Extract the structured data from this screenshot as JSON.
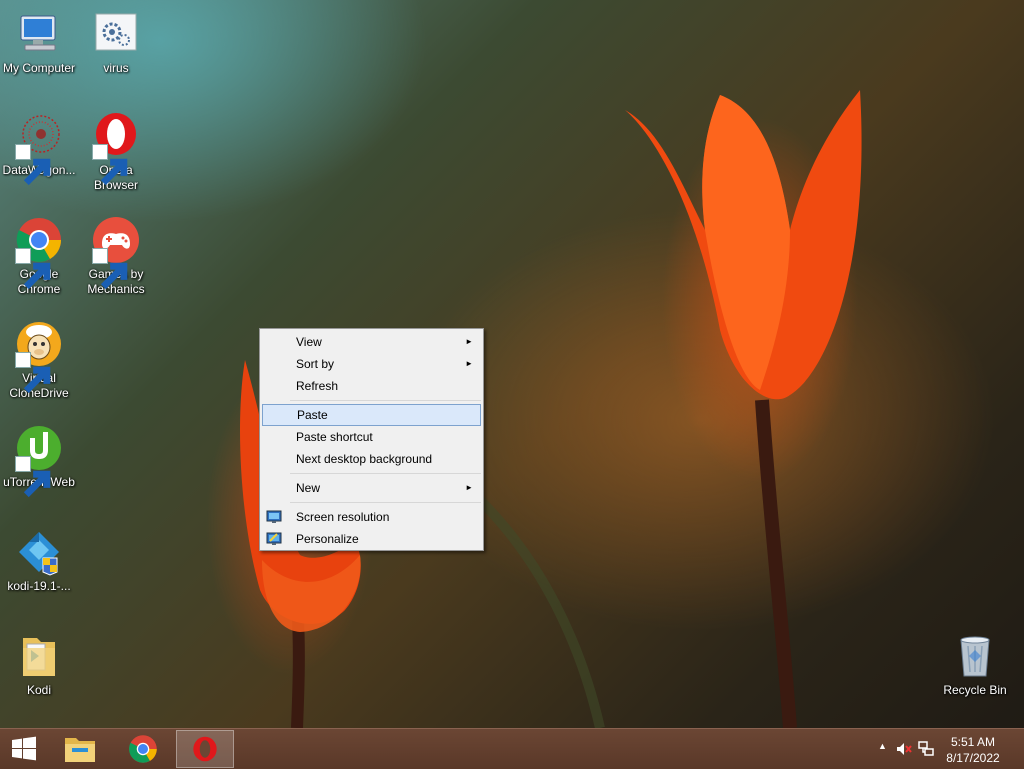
{
  "desktop": {
    "icons": [
      {
        "label": "My Computer",
        "icon": "computer-icon"
      },
      {
        "label": "virus",
        "icon": "settings-file-icon"
      },
      {
        "label": "DataWagon...",
        "icon": "datawagon-icon",
        "shortcut": true
      },
      {
        "label": "Opera Browser",
        "icon": "opera-icon",
        "shortcut": true
      },
      {
        "label": "Google Chrome",
        "icon": "chrome-icon",
        "shortcut": true
      },
      {
        "label": "Games by Mechanics",
        "icon": "gamepad-icon",
        "shortcut": true
      },
      {
        "label": "Virtual CloneDrive",
        "icon": "sheep-icon",
        "shortcut": true
      },
      {
        "label": "uTorrent Web",
        "icon": "utorrent-icon",
        "shortcut": true
      },
      {
        "label": "kodi-19.1-...",
        "icon": "kodi-installer-icon"
      },
      {
        "label": "Kodi",
        "icon": "folder-icon"
      },
      {
        "label": "Recycle Bin",
        "icon": "recycle-bin-icon"
      }
    ]
  },
  "context_menu": {
    "items": [
      {
        "label": "View",
        "submenu": true
      },
      {
        "label": "Sort by",
        "submenu": true
      },
      {
        "label": "Refresh"
      },
      {
        "label": "Paste",
        "highlighted": true
      },
      {
        "label": "Paste shortcut"
      },
      {
        "label": "Next desktop background"
      },
      {
        "label": "New",
        "submenu": true
      },
      {
        "label": "Screen resolution",
        "icon": "monitor-icon"
      },
      {
        "label": "Personalize",
        "icon": "personalize-icon"
      }
    ],
    "submenu_arrow": "►"
  },
  "taskbar": {
    "apps": [
      {
        "name": "File Explorer",
        "icon": "file-explorer-icon"
      },
      {
        "name": "Google Chrome",
        "icon": "chrome-icon"
      },
      {
        "name": "Opera",
        "icon": "opera-icon",
        "active": true
      }
    ],
    "tray": {
      "time": "5:51 AM",
      "date": "8/17/2022",
      "icons": [
        "show-hidden-icons-icon",
        "volume-muted-icon",
        "network-icon"
      ]
    }
  },
  "colors": {
    "taskbar": "#5a3828",
    "menu_background": "#f0f0f0",
    "menu_highlight": "#dae8fa",
    "menu_highlight_border": "#7da2ce"
  }
}
